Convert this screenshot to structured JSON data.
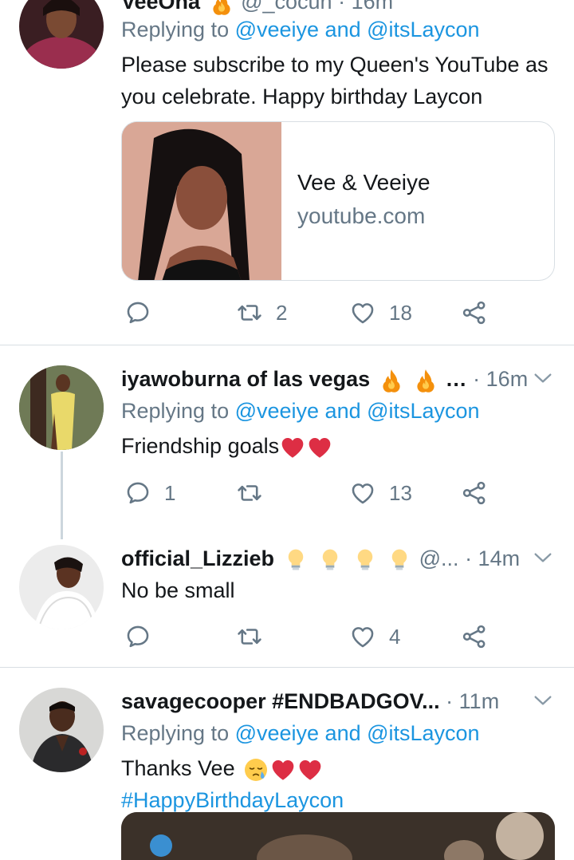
{
  "tweets": [
    {
      "name": "VeeOna",
      "handle": "@_cocun",
      "time": "· 16m",
      "replying_prefix": "Replying to ",
      "replying_to": "@veeiye and @itsLaycon",
      "text": "Please subscribe to my Queen's YouTube as you celebrate. Happy birthday Laycon",
      "card": {
        "title": "Vee & Veeiye",
        "domain": "youtube.com"
      },
      "replies": "",
      "retweets": "2",
      "likes": "18"
    },
    {
      "name": "iyawoburna of las vegas",
      "name_suffix": "…",
      "time": "· 16m",
      "replying_prefix": "Replying to ",
      "replying_to": "@veeiye and @itsLaycon",
      "text": "Friendship goals",
      "replies": "1",
      "retweets": "",
      "likes": "13"
    },
    {
      "name": "official_Lizzieb",
      "handle": "@...",
      "time": "· 14m",
      "text": "No be small",
      "replies": "",
      "retweets": "",
      "likes": "4"
    },
    {
      "name": "savagecooper #ENDBADGOV...",
      "time": "· 11m",
      "replying_prefix": "Replying to ",
      "replying_to": "@veeiye and @itsLaycon",
      "text": "Thanks Vee ",
      "hashtag": "#HappyBirthdayLaycon"
    }
  ],
  "colors": {
    "link": "#1b95e0",
    "secondary": "#657786",
    "divider": "#d8dee3",
    "heart": "#e0245e"
  },
  "icons": [
    "reply-icon",
    "retweet-icon",
    "like-icon",
    "share-icon",
    "caret-down-icon",
    "fire-emoji",
    "bulb-emoji",
    "heart-emoji",
    "sleepy-face-emoji"
  ]
}
